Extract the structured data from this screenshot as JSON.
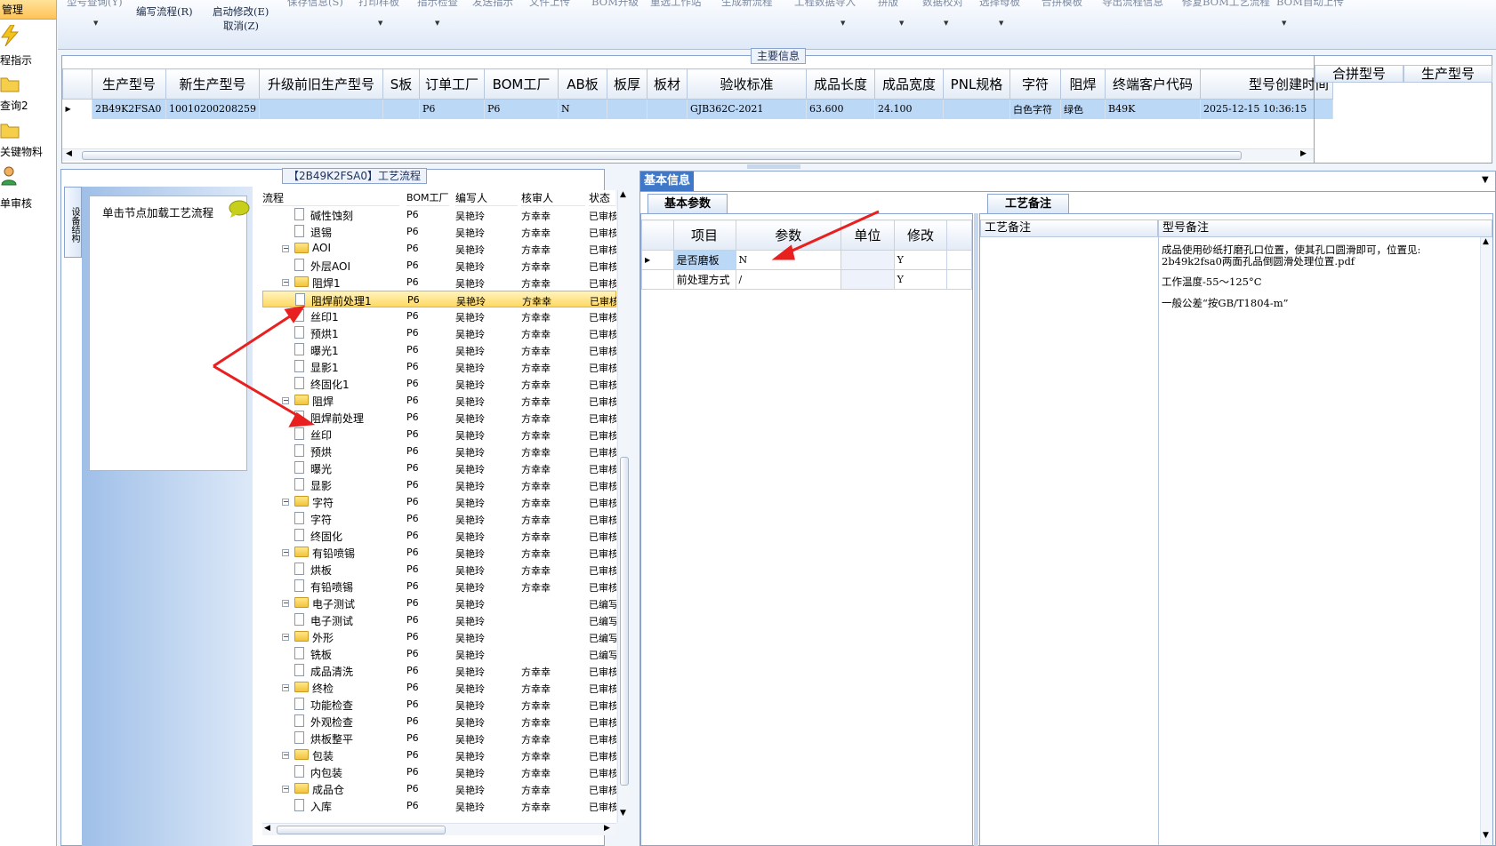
{
  "nav": {
    "header": "管理",
    "items": [
      {
        "label": "程指示",
        "icon": "lightning-icon"
      },
      {
        "label": "查询2",
        "icon": "folder-icon"
      },
      {
        "label": "关键物料",
        "icon": "folder-icon"
      },
      {
        "label": "单审核",
        "icon": "user-icon"
      }
    ]
  },
  "toolbar": {
    "write_flow": "编写流程(R)",
    "start_modify": "启动修改(E)",
    "cancel": "取消(Z)"
  },
  "main_info": {
    "title": "主要信息",
    "columns": [
      "生产型号",
      "新生产型号",
      "升级前旧生产型号",
      "S板",
      "订单工厂",
      "BOM工厂",
      "AB板",
      "板厚",
      "板材",
      "验收标准",
      "成品长度",
      "成品宽度",
      "PNL规格",
      "字符",
      "阻焊",
      "终端客户代码",
      "型号创建时间"
    ],
    "row": [
      "2B49K2FSA0",
      "10010200208259",
      "",
      "",
      "P6",
      "P6",
      "N",
      "",
      "",
      "GJB362C-2021",
      "63.600",
      "24.100",
      "",
      "白色字符",
      "绿色",
      "B49K",
      "2025-12-15 10:36:15"
    ],
    "side_columns": [
      "合拼型号",
      "生产型号"
    ]
  },
  "process": {
    "title": "【2B49K2FSA0】工艺流程",
    "side_tab": "设备结构",
    "hint": "单击节点加载工艺流程",
    "columns": [
      "流程",
      "BOM工厂",
      "编写人",
      "核审人",
      "状态"
    ],
    "rows": [
      {
        "name": "碱性蚀刻",
        "level": 2,
        "factory": "P6",
        "writer": "吴艳玲",
        "reviewer": "方幸幸",
        "status": "已审核"
      },
      {
        "name": "退锡",
        "level": 2,
        "factory": "P6",
        "writer": "吴艳玲",
        "reviewer": "方幸幸",
        "status": "已审核"
      },
      {
        "name": "AOI",
        "level": 1,
        "factory": "P6",
        "writer": "吴艳玲",
        "reviewer": "方幸幸",
        "status": "已审核"
      },
      {
        "name": "外层AOI",
        "level": 2,
        "factory": "P6",
        "writer": "吴艳玲",
        "reviewer": "方幸幸",
        "status": "已审核"
      },
      {
        "name": "阻焊1",
        "level": 1,
        "factory": "P6",
        "writer": "吴艳玲",
        "reviewer": "方幸幸",
        "status": "已审核"
      },
      {
        "name": "阻焊前处理1",
        "level": 2,
        "factory": "P6",
        "writer": "吴艳玲",
        "reviewer": "方幸幸",
        "status": "已审核",
        "selected": true
      },
      {
        "name": "丝印1",
        "level": 2,
        "factory": "P6",
        "writer": "吴艳玲",
        "reviewer": "方幸幸",
        "status": "已审核"
      },
      {
        "name": "预烘1",
        "level": 2,
        "factory": "P6",
        "writer": "吴艳玲",
        "reviewer": "方幸幸",
        "status": "已审核"
      },
      {
        "name": "曝光1",
        "level": 2,
        "factory": "P6",
        "writer": "吴艳玲",
        "reviewer": "方幸幸",
        "status": "已审核"
      },
      {
        "name": "显影1",
        "level": 2,
        "factory": "P6",
        "writer": "吴艳玲",
        "reviewer": "方幸幸",
        "status": "已审核"
      },
      {
        "name": "终固化1",
        "level": 2,
        "factory": "P6",
        "writer": "吴艳玲",
        "reviewer": "方幸幸",
        "status": "已审核"
      },
      {
        "name": "阻焊",
        "level": 1,
        "factory": "P6",
        "writer": "吴艳玲",
        "reviewer": "方幸幸",
        "status": "已审核"
      },
      {
        "name": "阻焊前处理",
        "level": 2,
        "factory": "P6",
        "writer": "吴艳玲",
        "reviewer": "方幸幸",
        "status": "已审核"
      },
      {
        "name": "丝印",
        "level": 2,
        "factory": "P6",
        "writer": "吴艳玲",
        "reviewer": "方幸幸",
        "status": "已审核"
      },
      {
        "name": "预烘",
        "level": 2,
        "factory": "P6",
        "writer": "吴艳玲",
        "reviewer": "方幸幸",
        "status": "已审核"
      },
      {
        "name": "曝光",
        "level": 2,
        "factory": "P6",
        "writer": "吴艳玲",
        "reviewer": "方幸幸",
        "status": "已审核"
      },
      {
        "name": "显影",
        "level": 2,
        "factory": "P6",
        "writer": "吴艳玲",
        "reviewer": "方幸幸",
        "status": "已审核"
      },
      {
        "name": "字符",
        "level": 1,
        "factory": "P6",
        "writer": "吴艳玲",
        "reviewer": "方幸幸",
        "status": "已审核"
      },
      {
        "name": "字符",
        "level": 2,
        "factory": "P6",
        "writer": "吴艳玲",
        "reviewer": "方幸幸",
        "status": "已审核"
      },
      {
        "name": "终固化",
        "level": 2,
        "factory": "P6",
        "writer": "吴艳玲",
        "reviewer": "方幸幸",
        "status": "已审核"
      },
      {
        "name": "有铅喷锡",
        "level": 1,
        "factory": "P6",
        "writer": "吴艳玲",
        "reviewer": "方幸幸",
        "status": "已审核"
      },
      {
        "name": "烘板",
        "level": 2,
        "factory": "P6",
        "writer": "吴艳玲",
        "reviewer": "方幸幸",
        "status": "已审核"
      },
      {
        "name": "有铅喷锡",
        "level": 2,
        "factory": "P6",
        "writer": "吴艳玲",
        "reviewer": "方幸幸",
        "status": "已审核"
      },
      {
        "name": "电子测试",
        "level": 1,
        "factory": "P6",
        "writer": "吴艳玲",
        "reviewer": "",
        "status": "已编写"
      },
      {
        "name": "电子测试",
        "level": 2,
        "factory": "P6",
        "writer": "吴艳玲",
        "reviewer": "",
        "status": "已编写"
      },
      {
        "name": "外形",
        "level": 1,
        "factory": "P6",
        "writer": "吴艳玲",
        "reviewer": "",
        "status": "已编写"
      },
      {
        "name": "铣板",
        "level": 2,
        "factory": "P6",
        "writer": "吴艳玲",
        "reviewer": "",
        "status": "已编写"
      },
      {
        "name": "成品清洗",
        "level": 2,
        "factory": "P6",
        "writer": "吴艳玲",
        "reviewer": "方幸幸",
        "status": "已审核"
      },
      {
        "name": "终检",
        "level": 1,
        "factory": "P6",
        "writer": "吴艳玲",
        "reviewer": "方幸幸",
        "status": "已审核"
      },
      {
        "name": "功能检查",
        "level": 2,
        "factory": "P6",
        "writer": "吴艳玲",
        "reviewer": "方幸幸",
        "status": "已审核"
      },
      {
        "name": "外观检查",
        "level": 2,
        "factory": "P6",
        "writer": "吴艳玲",
        "reviewer": "方幸幸",
        "status": "已审核"
      },
      {
        "name": "烘板整平",
        "level": 2,
        "factory": "P6",
        "writer": "吴艳玲",
        "reviewer": "方幸幸",
        "status": "已审核"
      },
      {
        "name": "包装",
        "level": 1,
        "factory": "P6",
        "writer": "吴艳玲",
        "reviewer": "方幸幸",
        "status": "已审核"
      },
      {
        "name": "内包装",
        "level": 2,
        "factory": "P6",
        "writer": "吴艳玲",
        "reviewer": "方幸幸",
        "status": "已审核"
      },
      {
        "name": "成品仓",
        "level": 1,
        "factory": "P6",
        "writer": "吴艳玲",
        "reviewer": "方幸幸",
        "status": "已审核"
      },
      {
        "name": "入库",
        "level": 2,
        "factory": "P6",
        "writer": "吴艳玲",
        "reviewer": "方幸幸",
        "status": "已审核"
      }
    ]
  },
  "basic_info": {
    "tab": "基本信息",
    "sub_tab": "基本参数",
    "columns": [
      "项目",
      "参数",
      "单位",
      "修改"
    ],
    "rows": [
      {
        "item": "是否磨板",
        "param": "N",
        "unit": "",
        "modify": "Y"
      },
      {
        "item": "前处理方式",
        "param": "/",
        "unit": "",
        "modify": "Y"
      }
    ]
  },
  "process_notes": {
    "tab": "工艺备注",
    "columns": [
      "工艺备注",
      "型号备注"
    ],
    "model_notes": [
      "成品使用砂纸打磨孔口位置，使其孔口圆滑即可，位置见:",
      "2b49k2fsa0两面孔品倒圆滑处理位置.pdf",
      "工作温度-55～125°C",
      "一般公差“按GB/T1804-m”"
    ]
  },
  "colors": {
    "accent": "#3f78c8",
    "selected_row": "#bcd8f7",
    "annotation": "#e8201f"
  }
}
